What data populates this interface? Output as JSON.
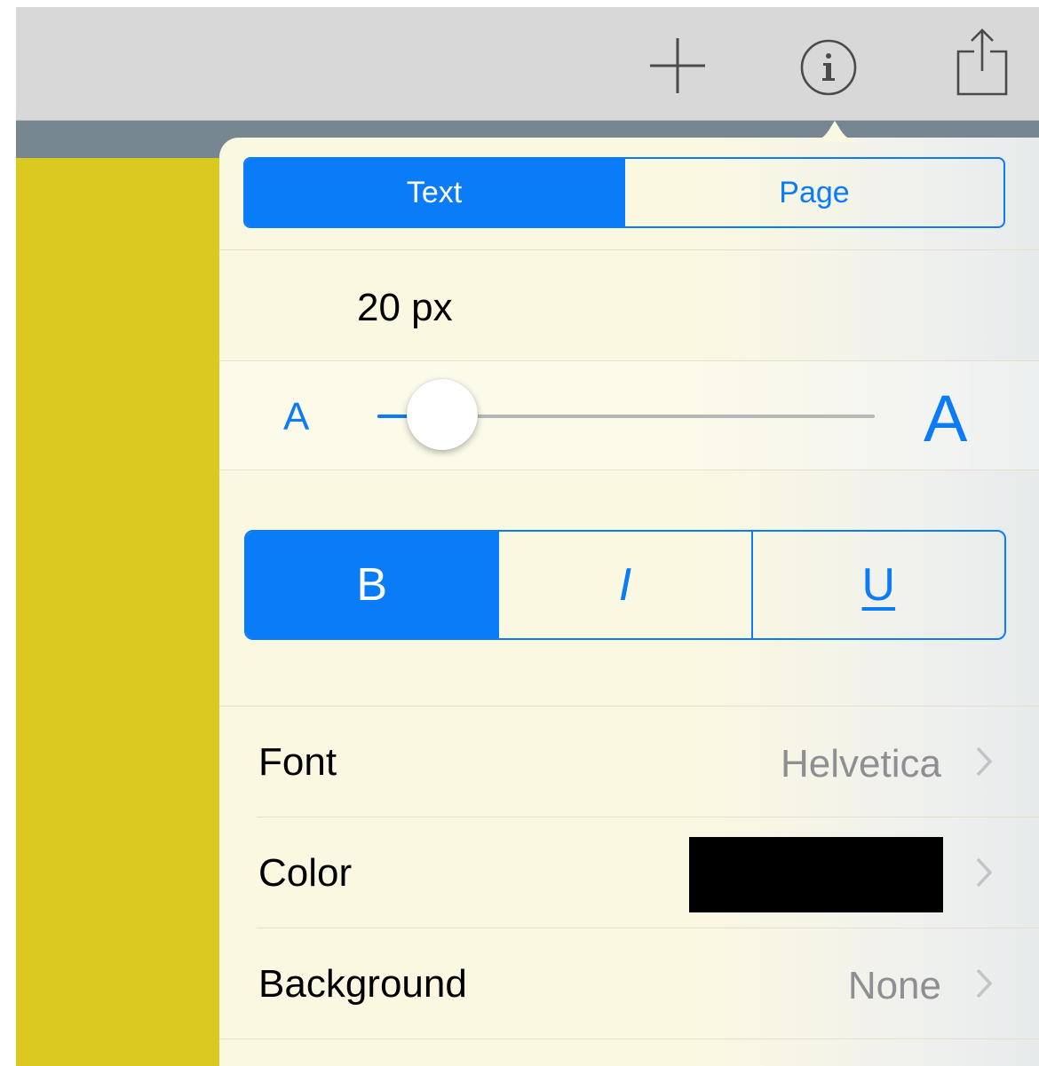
{
  "toolbar": {
    "icons": [
      "add-icon",
      "info-icon",
      "share-icon"
    ]
  },
  "colors": {
    "accent": "#0a7cf7",
    "toolbar": "#d8d8d8",
    "stripe": "#778791",
    "page": "#dbc820",
    "popover": "#fbf8e1"
  },
  "popover": {
    "tabs": [
      {
        "label": "Text",
        "selected": true
      },
      {
        "label": "Page",
        "selected": false
      }
    ],
    "font_size": {
      "value_text": "20 px",
      "slider_min_label": "A",
      "slider_max_label": "A",
      "slider_fraction": 0.13
    },
    "styles": [
      {
        "label": "B",
        "name": "bold",
        "selected": true
      },
      {
        "label": "I",
        "name": "italic",
        "selected": false
      },
      {
        "label": "U",
        "name": "underline",
        "selected": false
      }
    ],
    "rows": {
      "font": {
        "label": "Font",
        "value": "Helvetica"
      },
      "color": {
        "label": "Color",
        "swatch": "#000000"
      },
      "background": {
        "label": "Background",
        "value": "None"
      }
    }
  }
}
